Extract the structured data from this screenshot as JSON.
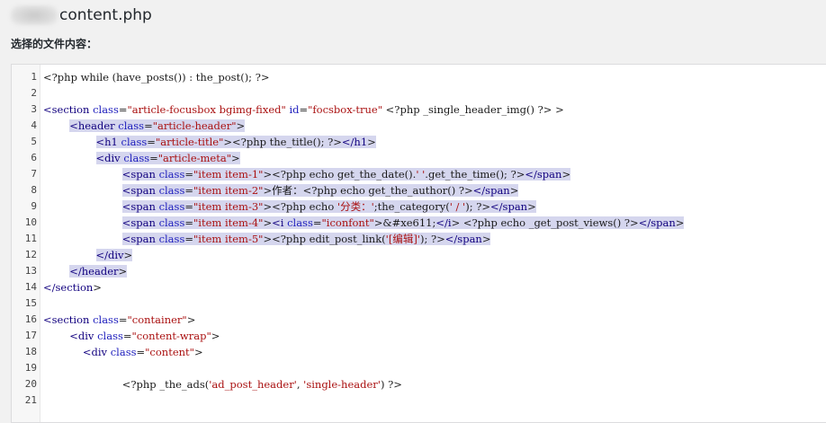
{
  "header": {
    "file_name": "content.php",
    "subtitle": "选择的文件内容："
  },
  "editor": {
    "lines": [
      {
        "num": "1",
        "text": "<?php while (have_posts()) : the_post(); ?>"
      },
      {
        "num": "2",
        "text": ""
      },
      {
        "num": "3",
        "text": "<section class=\"article-focusbox bgimg-fixed\" id=\"focsbox-true\" <?php _single_header_img() ?> >"
      },
      {
        "num": "4",
        "text": "        <header class=\"article-header\">"
      },
      {
        "num": "5",
        "text": "                <h1 class=\"article-title\"><?php the_title(); ?></h1>"
      },
      {
        "num": "6",
        "text": "                <div class=\"article-meta\">"
      },
      {
        "num": "7",
        "text": "                        <span class=\"item item-1\"><?php echo get_the_date().' '.get_the_time(); ?></span>"
      },
      {
        "num": "8",
        "text": "                        <span class=\"item item-2\">作者：<?php echo get_the_author() ?></span>"
      },
      {
        "num": "9",
        "text": "                        <span class=\"item item-3\"><?php echo '分类：';the_category(' / '); ?></span>"
      },
      {
        "num": "10",
        "text": "                        <span class=\"item item-4\"><i class=\"iconfont\">&#xe611;</i> <?php echo _get_post_views() ?></span>"
      },
      {
        "num": "11",
        "text": "                        <span class=\"item item-5\"><?php edit_post_link('[编辑]'); ?></span>"
      },
      {
        "num": "12",
        "text": "                </div>"
      },
      {
        "num": "13",
        "text": "        </header>"
      },
      {
        "num": "14",
        "text": "</section>"
      },
      {
        "num": "15",
        "text": ""
      },
      {
        "num": "16",
        "text": "<section class=\"container\">"
      },
      {
        "num": "17",
        "text": "        <div class=\"content-wrap\">"
      },
      {
        "num": "18",
        "text": "            <div class=\"content\">"
      },
      {
        "num": "19",
        "text": ""
      },
      {
        "num": "20",
        "text": "                        <?php _the_ads('ad_post_header', 'single-header') ?>"
      },
      {
        "num": "21",
        "text": ""
      }
    ]
  }
}
